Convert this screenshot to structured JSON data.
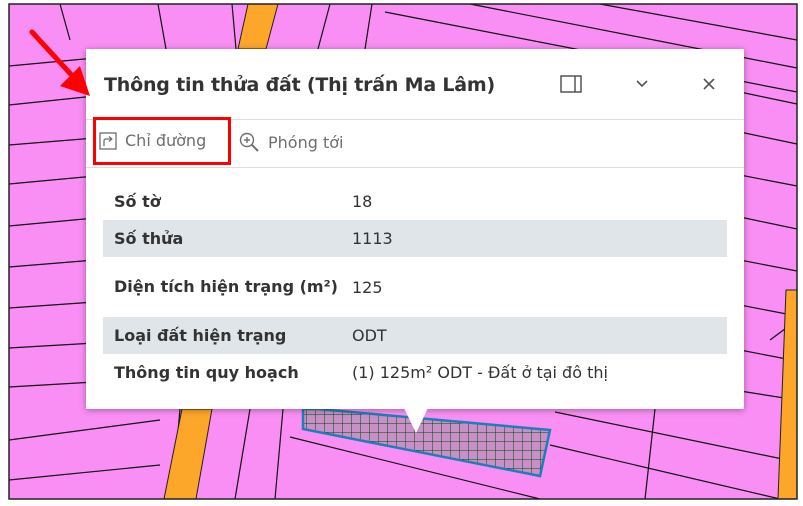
{
  "popup": {
    "title": "Thông tin thửa đất (Thị trấn Ma Lâm)",
    "dock_icon": "dock-panel-icon",
    "collapse_icon": "chevron-down-icon",
    "close_icon": "close-icon"
  },
  "actions": {
    "directions_label": "Chỉ đường",
    "directions_icon": "directions-arrow-icon",
    "zoom_label": "Phóng tới",
    "zoom_icon": "zoom-in-icon"
  },
  "attributes": [
    {
      "key": "Số tờ",
      "value": "18"
    },
    {
      "key": "Số thửa",
      "value": "1113"
    },
    {
      "key": "Diện tích hiện trạng (m²)",
      "value": "125"
    },
    {
      "key": "Loại đất hiện trạng",
      "value": "ODT"
    },
    {
      "key": "Thông tin quy hoạch",
      "value": "(1) 125m² ODT - Đất ở tại đô thị"
    }
  ],
  "colors": {
    "land_parcel": "#f98ef4",
    "road": "#fca62a",
    "selected_hatch": "#006400",
    "highlight_box": "#ff0000",
    "annotation_arrow": "#ff0000"
  }
}
